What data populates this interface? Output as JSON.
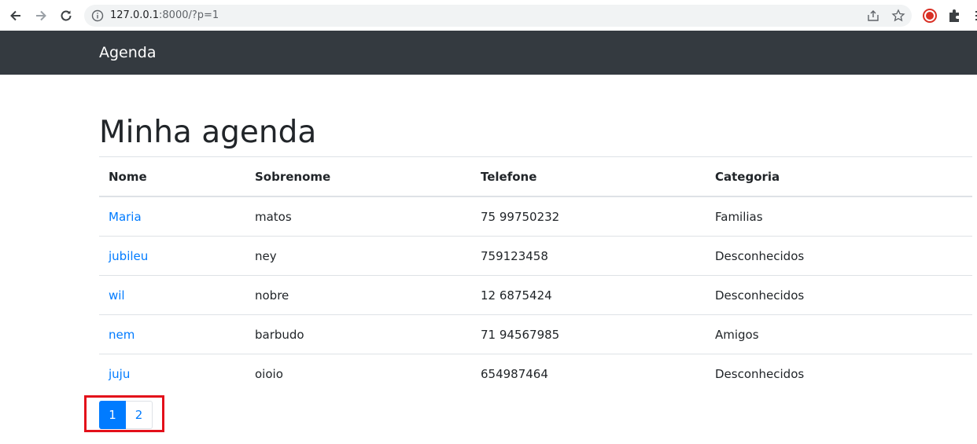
{
  "browser": {
    "url_host": "127.0.0.1",
    "url_rest": ":8000/?p=1",
    "icons": [
      "back-arrow-icon",
      "forward-arrow-icon",
      "reload-icon",
      "info-icon",
      "share-icon",
      "bookmark-star-icon",
      "record-extension-icon",
      "puzzle-extensions-icon",
      "menu-icon"
    ]
  },
  "navbar": {
    "brand": "Agenda",
    "background": "#343a40"
  },
  "main": {
    "title": "Minha agenda",
    "table": {
      "headers": [
        "Nome",
        "Sobrenome",
        "Telefone",
        "Categoria"
      ],
      "rows": [
        [
          "Maria",
          "matos",
          "75 99750232",
          "Familias"
        ],
        [
          "jubileu",
          "ney",
          "759123458",
          "Desconhecidos"
        ],
        [
          "wil",
          "nobre",
          "12 6875424",
          "Desconhecidos"
        ],
        [
          "nem",
          "barbudo",
          "71 94567985",
          "Amigos"
        ],
        [
          "juju",
          "oioio",
          "654987464",
          "Desconhecidos"
        ]
      ]
    },
    "pagination": {
      "pages": [
        "1",
        "2"
      ],
      "current": "1"
    }
  },
  "colors": {
    "link": "#007bff",
    "active_page": "#007bff",
    "highlight_box": "#e3101a"
  }
}
